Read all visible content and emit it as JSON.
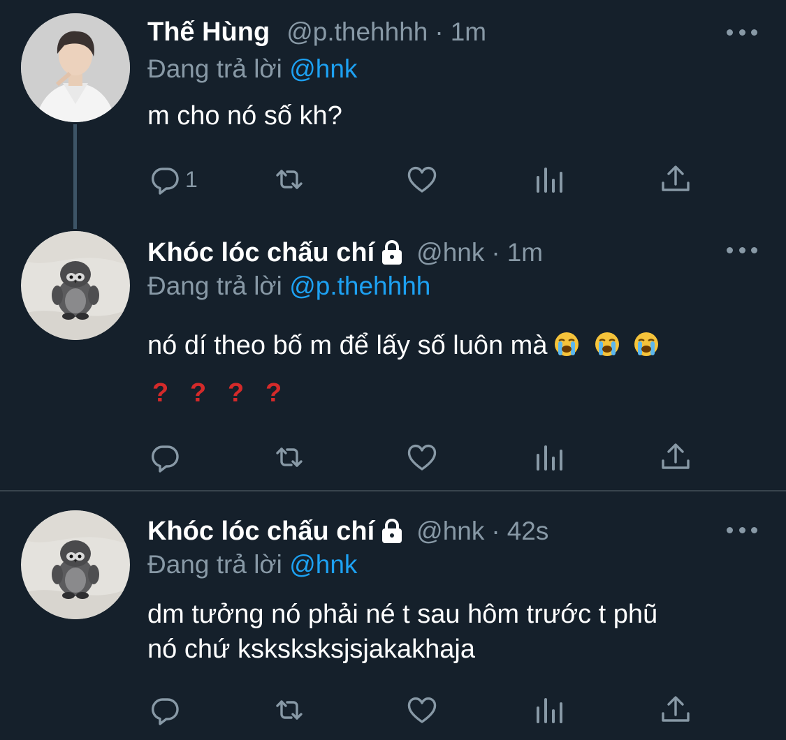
{
  "tweets": [
    {
      "name": "Thế Hùng",
      "handle": "@p.thehhhh",
      "separator": "·",
      "time": "1m",
      "reply_prefix": "Đang trả lời",
      "reply_to": "@hnk",
      "text": "m cho nó số kh?",
      "reply_count": "1",
      "avatar_icon": "person-white-shirt-avatar"
    },
    {
      "name": "Khóc lóc chấu chí",
      "locked": true,
      "handle": "@hnk",
      "separator": "·",
      "time": "1m",
      "reply_prefix": "Đang trả lời",
      "reply_to": "@p.thehhhh",
      "text": "nó dí theo bố m để lấy số luôn mà",
      "emojis": [
        "loudly-crying-face",
        "loudly-crying-face",
        "loudly-crying-face"
      ],
      "question_marks": [
        "?",
        "?",
        "?",
        "?"
      ],
      "avatar_icon": "penguin-plush-avatar"
    },
    {
      "name": "Khóc lóc chấu chí",
      "locked": true,
      "handle": "@hnk",
      "separator": "·",
      "time": "42s",
      "reply_prefix": "Đang trả lời",
      "reply_to": "@hnk",
      "text_line1": "dm tưởng nó phải né t sau hôm trước t phũ",
      "text_line2": "nó chứ ksksksksjsjakakhaja",
      "avatar_icon": "penguin-plush-avatar"
    }
  ],
  "action_icons": [
    "reply-icon",
    "retweet-icon",
    "like-icon",
    "analytics-icon",
    "share-icon"
  ],
  "colors": {
    "background": "#15202b",
    "secondary_text": "#8899a6",
    "mention": "#1da1f2",
    "divider": "#38444d",
    "question_mark": "#d42a2a"
  }
}
